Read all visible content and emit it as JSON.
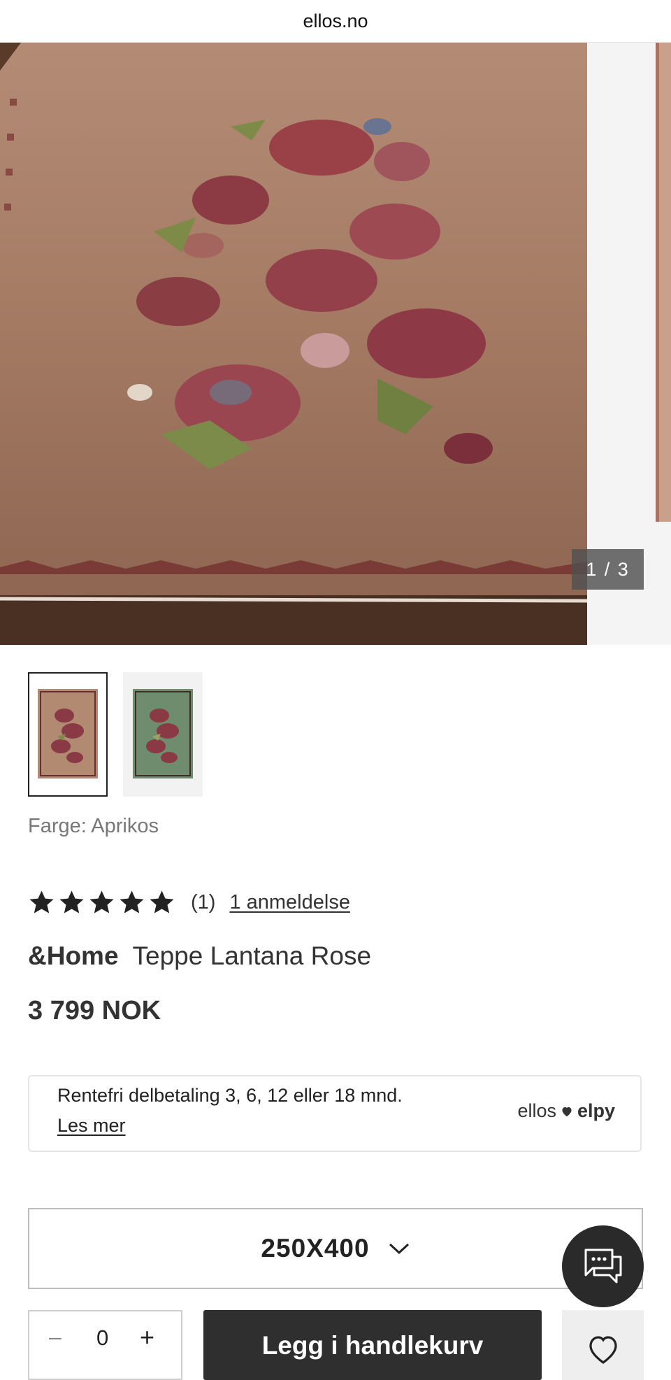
{
  "browser": {
    "url": "ellos.no"
  },
  "gallery": {
    "counter": "1 / 3"
  },
  "product": {
    "color_label": "Farge: Aprikos",
    "rating": {
      "stars": 5,
      "max": 5,
      "count": "(1)",
      "reviews_link": "1 anmeldelse"
    },
    "brand": "&Home",
    "name": "Teppe Lantana Rose",
    "price": "3 799 NOK"
  },
  "financing": {
    "text": "Rentefri delbetaling 3, 6, 12 eller 18 mnd.",
    "link": "Les mer",
    "logo_left": "ellos",
    "logo_right": "elpy"
  },
  "size_select": {
    "value": "250X400"
  },
  "quantity": {
    "value": "0",
    "minus": "–",
    "plus": "+"
  },
  "actions": {
    "add_to_cart": "Legg i handlekurv"
  },
  "icons": {
    "chat": "chat-bubbles-icon",
    "wishlist": "heart-icon",
    "dropdown": "chevron-down-icon",
    "star": "star-icon"
  },
  "colors": {
    "dark": "#2f2f2f",
    "border": "#e6e6e6",
    "muted": "#777777"
  }
}
